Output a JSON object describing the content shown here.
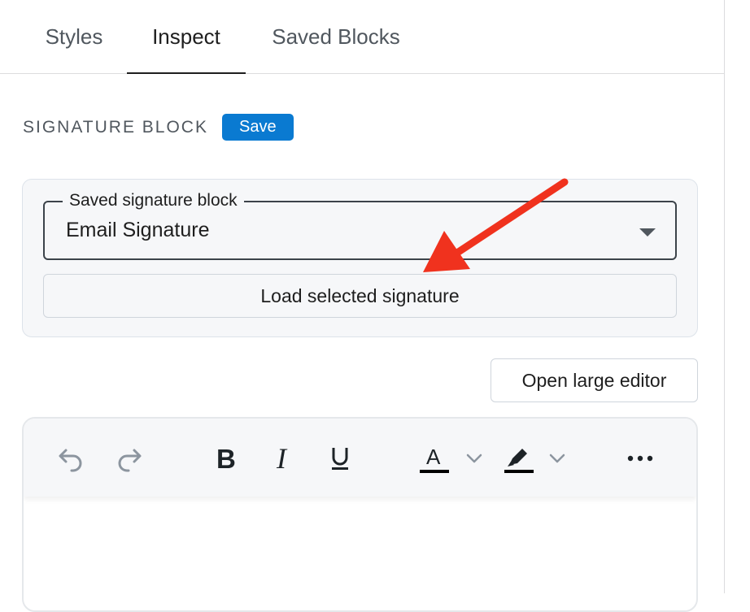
{
  "tabs": [
    {
      "label": "Styles",
      "active": false
    },
    {
      "label": "Inspect",
      "active": true
    },
    {
      "label": "Saved Blocks",
      "active": false
    }
  ],
  "section": {
    "title": "SIGNATURE BLOCK",
    "save_label": "Save"
  },
  "signature_select": {
    "legend": "Saved signature block",
    "selected": "Email Signature"
  },
  "load_button_label": "Load selected signature",
  "open_editor_label": "Open large editor",
  "toolbar_icons": [
    "undo-icon",
    "redo-icon",
    "bold-icon",
    "italic-icon",
    "underline-icon",
    "text-color-icon",
    "chevron-down-icon",
    "highlight-icon",
    "chevron-down-icon",
    "more-icon"
  ],
  "colors": {
    "accent": "#0a7ad1",
    "annotation_arrow": "#f0321e"
  }
}
